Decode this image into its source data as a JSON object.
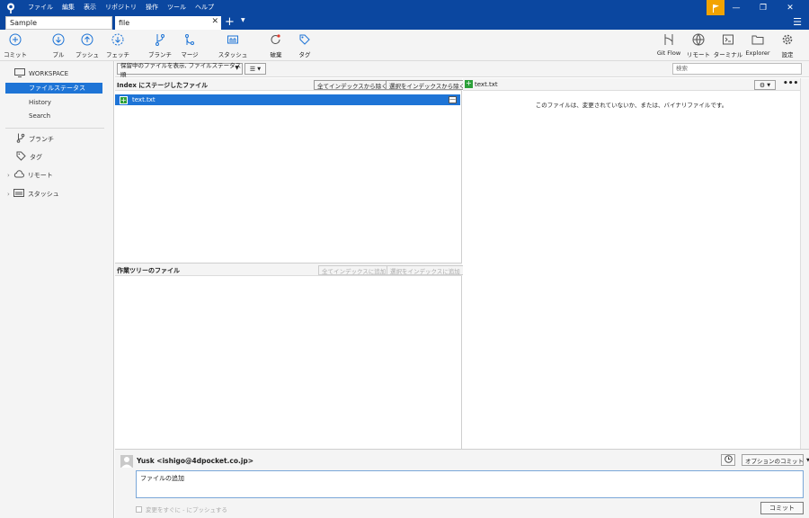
{
  "menu": [
    "ファイル",
    "編集",
    "表示",
    "リポジトリ",
    "操作",
    "ツール",
    "ヘルプ"
  ],
  "tabs": [
    {
      "label": "Sample"
    },
    {
      "label": "file"
    }
  ],
  "toolbar": {
    "left": [
      {
        "label": "コミット",
        "icon": "commit-icon"
      },
      {
        "label": "プル",
        "icon": "pull-icon"
      },
      {
        "label": "プッシュ",
        "icon": "push-icon"
      },
      {
        "label": "フェッチ",
        "icon": "fetch-icon"
      },
      {
        "label": "ブランチ",
        "icon": "branch-icon"
      },
      {
        "label": "マージ",
        "icon": "merge-icon"
      },
      {
        "label": "スタッシュ",
        "icon": "stash-icon"
      },
      {
        "label": "破棄",
        "icon": "discard-icon"
      },
      {
        "label": "タグ",
        "icon": "tag-icon"
      }
    ],
    "right": [
      {
        "label": "Git Flow",
        "icon": "git-flow-icon"
      },
      {
        "label": "リモート",
        "icon": "remote-icon"
      },
      {
        "label": "ターミナル",
        "icon": "terminal-icon"
      },
      {
        "label": "Explorer",
        "icon": "explorer-icon"
      },
      {
        "label": "設定",
        "icon": "settings-icon"
      }
    ]
  },
  "sidebar": {
    "workspace": "WORKSPACE",
    "items": [
      {
        "label": "ファイルステータス",
        "active": true
      },
      {
        "label": "History",
        "active": false
      },
      {
        "label": "Search",
        "active": false
      }
    ],
    "groups": [
      {
        "label": "ブランチ",
        "icon": "branch-icon"
      },
      {
        "label": "タグ",
        "icon": "tag-icon"
      },
      {
        "label": "リモート",
        "icon": "cloud-icon"
      },
      {
        "label": "スタッシュ",
        "icon": "stash-icon"
      }
    ]
  },
  "filter": {
    "select": "保留中のファイルを表示, ファイルステータス順",
    "search_placeholder": "検索"
  },
  "staged": {
    "title": "Index にステージしたファイル",
    "unstage_all": "全てインデックスから除く",
    "unstage_selected": "選択をインデックスから除く",
    "files": [
      "text.txt"
    ]
  },
  "working": {
    "title": "作業ツリーのファイル",
    "stage_all": "全てインデックスに追加",
    "stage_selected": "選択をインデックスに追加"
  },
  "diff": {
    "file": "text.txt",
    "message": "このファイルは、変更されていないか、または、バイナリファイルです。"
  },
  "commit": {
    "author": "Yusk <ishigo@4dpocket.co.jp>",
    "options": "オプションのコミット",
    "message": "ファイルの追加",
    "push_now": "変更をすぐに - にプッシュする",
    "button": "コミット"
  },
  "colors": {
    "titlebar": "#0b47a0",
    "accent": "#1e74d6",
    "flag": "#f2a300",
    "added": "#2ca03a"
  }
}
